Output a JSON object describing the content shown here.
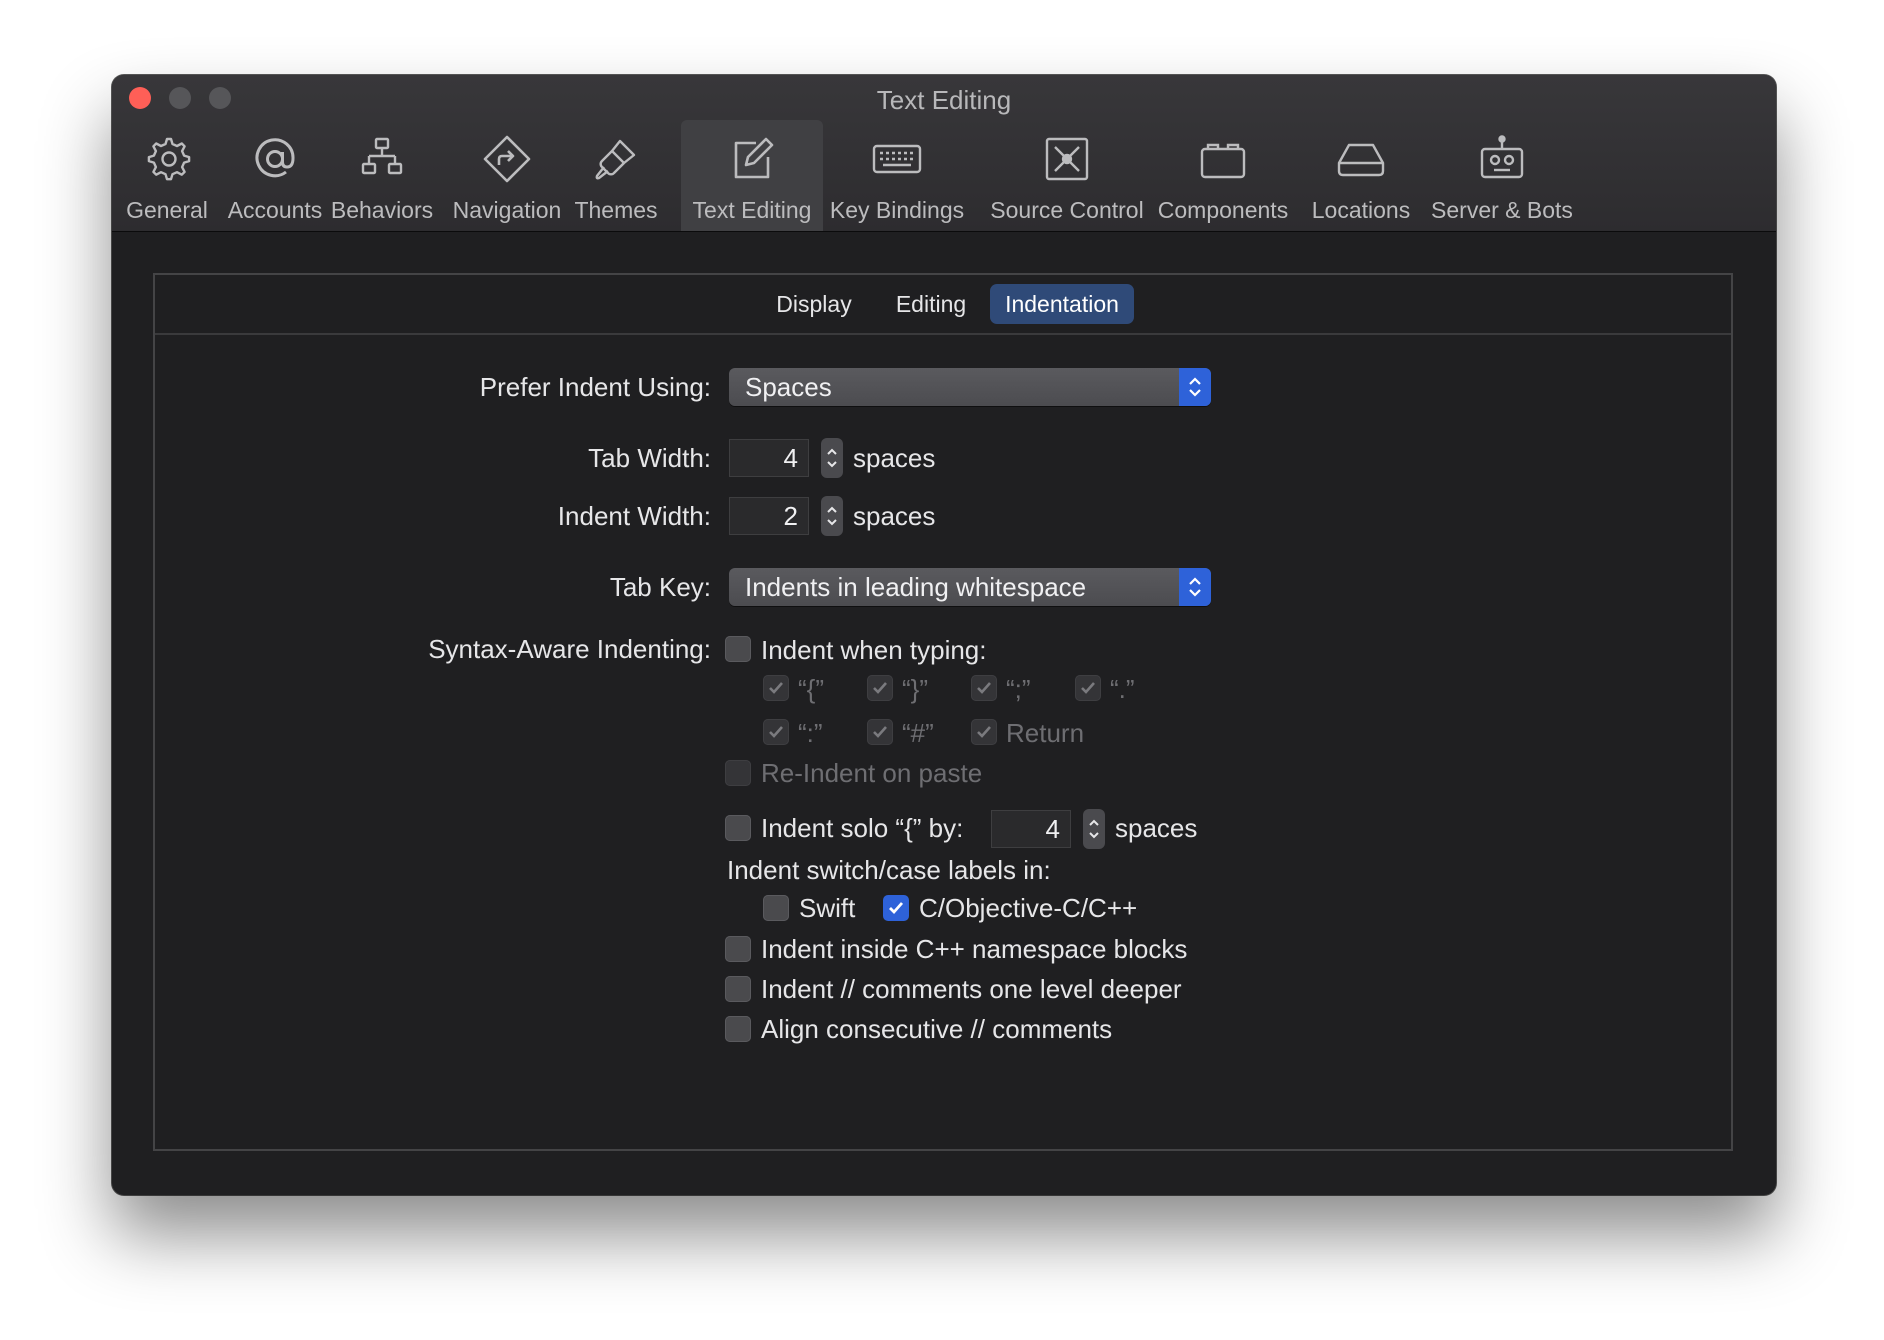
{
  "window": {
    "title": "Text Editing"
  },
  "toolbar": {
    "items": [
      {
        "label": "General",
        "icon": "gear-icon"
      },
      {
        "label": "Accounts",
        "icon": "at-icon"
      },
      {
        "label": "Behaviors",
        "icon": "hierarchy-icon"
      },
      {
        "label": "Navigation",
        "icon": "navigation-diamond-icon"
      },
      {
        "label": "Themes",
        "icon": "paintbrush-icon"
      },
      {
        "label": "Text Editing",
        "icon": "compose-icon",
        "selected": true
      },
      {
        "label": "Key Bindings",
        "icon": "keyboard-icon"
      },
      {
        "label": "Source Control",
        "icon": "source-control-icon"
      },
      {
        "label": "Components",
        "icon": "components-icon"
      },
      {
        "label": "Locations",
        "icon": "drive-icon"
      },
      {
        "label": "Server & Bots",
        "icon": "robot-icon"
      }
    ]
  },
  "tabs": {
    "display": "Display",
    "editing": "Editing",
    "indentation": "Indentation",
    "active": "indentation"
  },
  "form": {
    "prefer_indent": {
      "label": "Prefer Indent Using:",
      "value": "Spaces"
    },
    "tab_width": {
      "label": "Tab Width:",
      "value": "4",
      "unit": "spaces"
    },
    "indent_width": {
      "label": "Indent Width:",
      "value": "2",
      "unit": "spaces"
    },
    "tab_key": {
      "label": "Tab Key:",
      "value": "Indents in leading whitespace"
    },
    "syntax_aware": {
      "label": "Syntax-Aware Indenting:",
      "indent_when_typing": {
        "label": "Indent when typing:",
        "checked": false
      },
      "chars": [
        {
          "label": "“{”",
          "checked": true
        },
        {
          "label": "“}”",
          "checked": true
        },
        {
          "label": "“;”",
          "checked": true
        },
        {
          "label": "“.”",
          "checked": true
        },
        {
          "label": "“:”",
          "checked": true
        },
        {
          "label": "“#”",
          "checked": true
        },
        {
          "label": "Return",
          "checked": true
        }
      ],
      "reindent_on_paste": {
        "label": "Re-Indent on paste",
        "checked": false
      }
    },
    "indent_solo": {
      "label": "Indent solo “{” by:",
      "value": "4",
      "unit": "spaces",
      "checked": false
    },
    "switch_case": {
      "label": "Indent switch/case labels in:",
      "swift": {
        "label": "Swift",
        "checked": false
      },
      "c_family": {
        "label": "C/Objective-C/C++",
        "checked": true
      }
    },
    "cpp_namespace": {
      "label": "Indent inside C++ namespace blocks",
      "checked": false
    },
    "comments_deeper": {
      "label": "Indent // comments one level deeper",
      "checked": false
    },
    "align_comments": {
      "label": "Align consecutive // comments",
      "checked": false
    }
  },
  "colors": {
    "accent": "#2e62d9",
    "close": "#fe5f57",
    "window_bg": "#1f1f21"
  }
}
